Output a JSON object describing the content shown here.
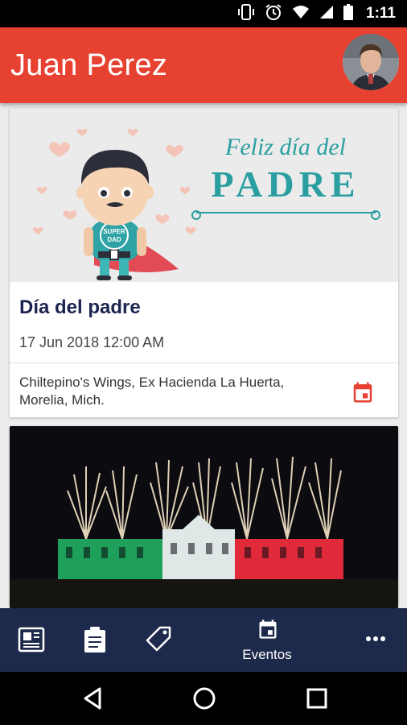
{
  "status_bar": {
    "time": "1:11",
    "icons": [
      "vibrate-icon",
      "alarm-icon",
      "wifi-icon",
      "signal-icon",
      "battery-icon"
    ]
  },
  "app_bar": {
    "title": "Juan Perez",
    "avatar": "profile-avatar"
  },
  "events": [
    {
      "banner_text_script": "Feliz día del",
      "banner_text_main": "PADRE",
      "banner_badge": [
        "SUPER",
        "DAD"
      ],
      "title": "Día del padre",
      "date": "17 Jun 2018 12:00 AM",
      "place": "Chiltepino's Wings, Ex Hacienda La Huerta, Morelia, Mich.",
      "action_icon": "calendar-icon"
    },
    {
      "image": "fireworks-over-palace"
    }
  ],
  "bottom_nav": {
    "items": [
      {
        "icon": "newspaper-icon",
        "label": ""
      },
      {
        "icon": "clipboard-icon",
        "label": ""
      },
      {
        "icon": "tag-icon",
        "label": ""
      },
      {
        "icon": "calendar-icon",
        "label": "Eventos",
        "selected": true
      },
      {
        "icon": "more-icon",
        "label": ""
      }
    ]
  },
  "colors": {
    "app_bar": "#e74131",
    "bottom_nav": "#1e2a4c",
    "title_text": "#1c2450",
    "banner_teal": "#2a9ea0"
  }
}
